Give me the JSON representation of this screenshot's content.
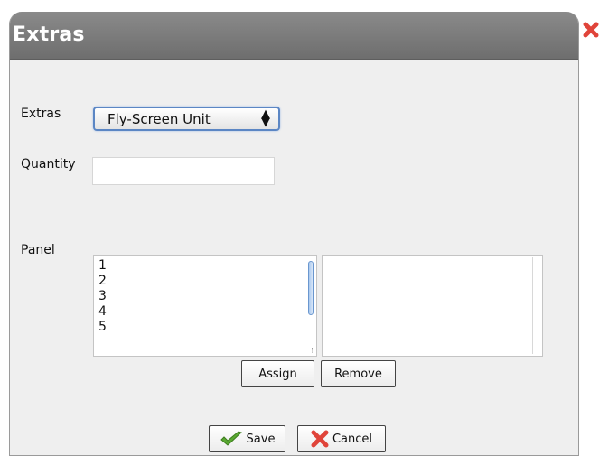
{
  "dialog": {
    "title": "Extras"
  },
  "form": {
    "extras_label": "Extras",
    "extras_selected": "Fly-Screen Unit",
    "quantity_label": "Quantity",
    "quantity_value": "",
    "panel_label": "Panel",
    "panel_available": [
      "1",
      "2",
      "3",
      "4",
      "5"
    ],
    "panel_assigned": []
  },
  "buttons": {
    "assign": "Assign",
    "remove": "Remove",
    "save": "Save",
    "cancel": "Cancel"
  },
  "icons": {
    "close": "close-icon",
    "save": "checkmark-icon",
    "cancel": "x-icon",
    "select_arrows": "updown-arrows-icon"
  },
  "colors": {
    "titlebar": "#7a7a7a",
    "dialog_bg": "#efefef",
    "select_focus": "#5b86c4",
    "save_check": "#5aa832",
    "cancel_x": "#e0443a"
  }
}
